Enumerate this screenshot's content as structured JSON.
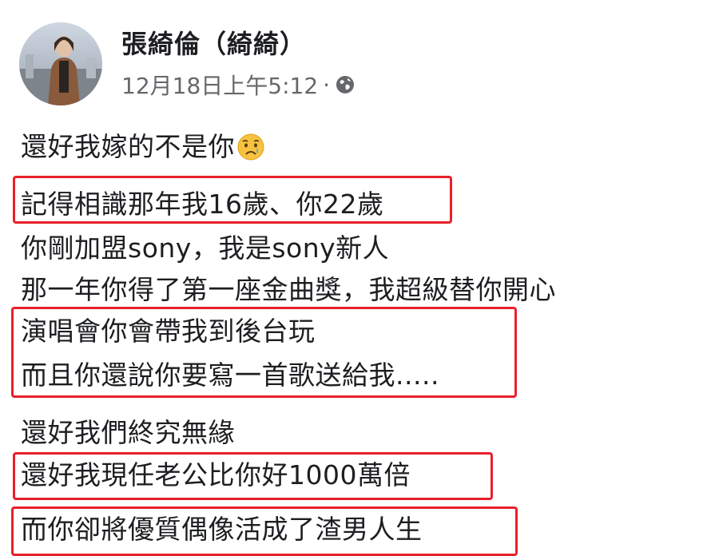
{
  "post": {
    "author_name": "張綺倫（綺綺）",
    "timestamp": "12月18日上午5:12",
    "separator": "·",
    "privacy_icon": "globe-icon",
    "lines": [
      "還好我嫁的不是你",
      "記得相識那年我16歲、你22歲",
      "你剛加盟sony，我是sony新人",
      "那一年你得了第一座金曲獎，我超級替你開心",
      "演唱會你會帶我到後台玩",
      "而且你還說你要寫一首歌送給我.....",
      "還好我們終究無緣",
      "還好我現任老公比你好1000萬倍",
      "而你卻將優質偶像活成了渣男人生"
    ],
    "emoji": "sad-face-emoji",
    "highlight_color": "#e8202a"
  }
}
